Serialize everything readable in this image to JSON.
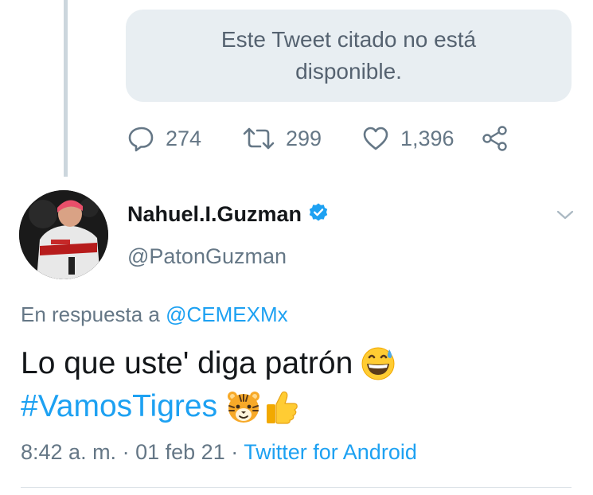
{
  "quoted_tweet": {
    "unavailable_text": "Este Tweet citado no está disponible."
  },
  "parent_actions": {
    "reply_icon": "reply-bubble-icon",
    "reply_count": "274",
    "retweet_icon": "retweet-icon",
    "retweet_count": "299",
    "like_icon": "heart-icon",
    "like_count": "1,396",
    "share_icon": "share-icon"
  },
  "tweet": {
    "author": {
      "display_name": "Nahuel.I.Guzman",
      "verified_icon": "verified-badge-icon",
      "handle": "@PatonGuzman"
    },
    "menu_icon": "chevron-down-icon",
    "reply_prefix": "En respuesta a",
    "reply_mention": "@CEMEXMx",
    "text_line1": "Lo que uste' diga patrón",
    "emoji_1": "grinning-sweat-emoji",
    "hashtag": "#VamosTigres",
    "emoji_2": "tiger-face-emoji",
    "emoji_3": "thumbs-up-emoji",
    "time": "8:42 a. m.",
    "separator": "·",
    "date": "01 feb 21",
    "source": "Twitter for Android"
  },
  "colors": {
    "accent": "#1da1f2",
    "secondary_text": "#657786",
    "quote_background": "#e8eef2"
  }
}
